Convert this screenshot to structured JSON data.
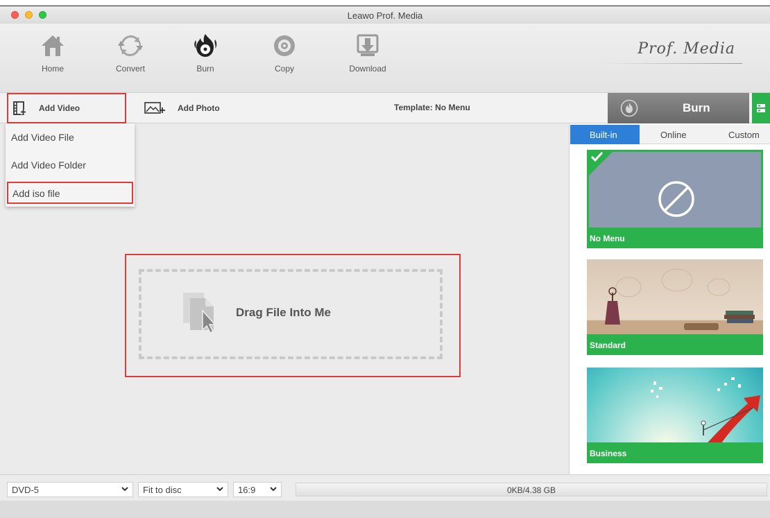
{
  "window": {
    "title": "Leawo Prof. Media"
  },
  "toolbar": {
    "items": [
      {
        "label": "Home",
        "icon": "home-icon"
      },
      {
        "label": "Convert",
        "icon": "convert-icon"
      },
      {
        "label": "Burn",
        "icon": "burn-icon"
      },
      {
        "label": "Copy",
        "icon": "copy-icon"
      },
      {
        "label": "Download",
        "icon": "download-icon"
      }
    ],
    "brand": "Prof. Media"
  },
  "actionbar": {
    "add_video": "Add Video",
    "add_photo": "Add Photo",
    "template": "Template: No Menu",
    "burn": "Burn"
  },
  "add_video_menu": {
    "items": [
      "Add Video File",
      "Add Video Folder",
      "Add iso file"
    ]
  },
  "dropzone": {
    "text": "Drag File Into Me"
  },
  "template_panel": {
    "tabs": [
      "Built-in",
      "Online",
      "Custom"
    ],
    "active_tab": "Built-in",
    "templates": [
      {
        "name": "No Menu",
        "selected": true
      },
      {
        "name": "Standard",
        "selected": false
      },
      {
        "name": "Business",
        "selected": false
      }
    ]
  },
  "bottombar": {
    "disc_type": "DVD-5",
    "fit_mode": "Fit to disc",
    "aspect_ratio": "16:9",
    "capacity": "0KB/4.38 GB"
  },
  "colors": {
    "accent_green": "#2bb24c",
    "tab_blue": "#2d7fd8",
    "highlight_red": "#e23a3a"
  }
}
